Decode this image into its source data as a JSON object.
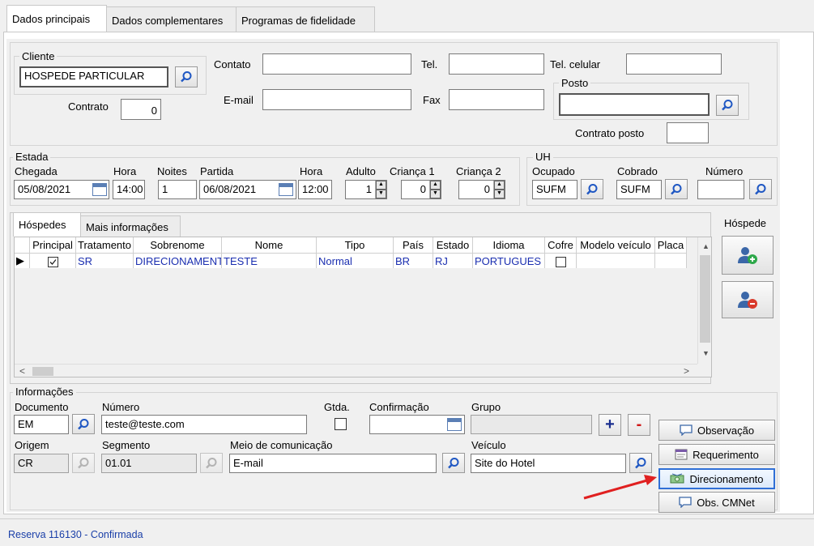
{
  "tabs": [
    "Dados principais",
    "Dados complementares",
    "Programas de fidelidade"
  ],
  "cliente": {
    "group_title": "Cliente",
    "value": "HOSPEDE PARTICULAR",
    "contrato_label": "Contrato",
    "contrato_value": "0"
  },
  "contato": {
    "label": "Contato",
    "value": ""
  },
  "tel": {
    "label": "Tel.",
    "value": ""
  },
  "tel_celular": {
    "label": "Tel. celular",
    "value": ""
  },
  "email": {
    "label": "E-mail",
    "value": ""
  },
  "fax": {
    "label": "Fax",
    "value": ""
  },
  "posto": {
    "group_title": "Posto",
    "value": "",
    "contrato_label": "Contrato posto",
    "contrato_value": ""
  },
  "estada": {
    "group_title": "Estada",
    "chegada_label": "Chegada",
    "chegada": "05/08/2021",
    "hora_label": "Hora",
    "hora_chegada": "14:00",
    "noites_label": "Noites",
    "noites": "1",
    "partida_label": "Partida",
    "partida": "06/08/2021",
    "hora_partida": "12:00",
    "adulto_label": "Adulto",
    "adulto": "1",
    "crianca1_label": "Criança 1",
    "crianca1": "0",
    "crianca2_label": "Criança 2",
    "crianca2": "0"
  },
  "uh": {
    "group_title": "UH",
    "ocupado_label": "Ocupado",
    "ocupado": "SUFM",
    "cobrado_label": "Cobrado",
    "cobrado": "SUFM",
    "numero_label": "Número",
    "numero": ""
  },
  "hospedes": {
    "tabs": [
      "Hóspedes",
      "Mais informações"
    ],
    "side_title": "Hóspede",
    "columns": [
      "Principal",
      "Tratamento",
      "Sobrenome",
      "Nome",
      "Tipo",
      "País",
      "Estado",
      "Idioma",
      "Cofre",
      "Modelo veículo",
      "Placa"
    ],
    "row": {
      "tratamento": "SR",
      "sobrenome": "DIRECIONAMENT",
      "nome": "TESTE",
      "tipo": "Normal",
      "pais": "BR",
      "estado": "RJ",
      "idioma": "PORTUGUES"
    }
  },
  "informacoes": {
    "group_title": "Informações",
    "documento_label": "Documento",
    "documento": "EM",
    "numero_label": "Número",
    "numero": "teste@teste.com",
    "gtda_label": "Gtda.",
    "confirmacao_label": "Confirmação",
    "confirmacao": "",
    "grupo_label": "Grupo",
    "grupo": "",
    "origem_label": "Origem",
    "origem": "CR",
    "segmento_label": "Segmento",
    "segmento": "01.01",
    "meio_label": "Meio de comunicação",
    "meio": "E-mail",
    "veiculo_label": "Veículo",
    "veiculo": "Site do Hotel"
  },
  "buttons": {
    "plus": "+",
    "minus": "-",
    "observacao": "Observação",
    "requerimento": "Requerimento",
    "direcionamento": "Direcionamento",
    "obs_cmnet": "Obs. CMNet"
  },
  "status": "Reserva 116130 - Confirmada",
  "colors": {
    "accent_text": "#1a2eb0",
    "arrow": "#e02020",
    "status_text": "#1a3fa8",
    "highlight_border": "#2f6fd6"
  }
}
